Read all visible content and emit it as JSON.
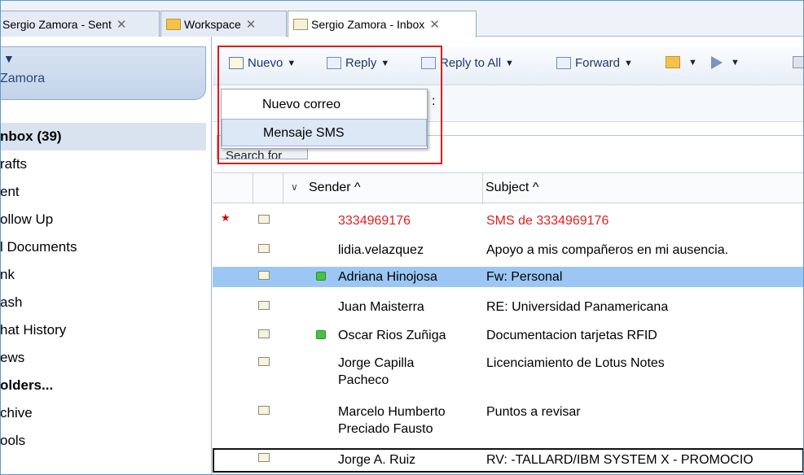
{
  "tabs": [
    {
      "label": "Sergio Zamora - Sent",
      "icon": "none"
    },
    {
      "label": "Workspace",
      "icon": "folder-icon"
    },
    {
      "label": "Sergio Zamora - Inbox",
      "icon": "mail-icon"
    }
  ],
  "tab_close": "✕",
  "navigator": {
    "arrow": "▼",
    "user_name": "Zamora",
    "items": [
      {
        "label": "nbox (39)",
        "selected": true
      },
      {
        "label": "rafts"
      },
      {
        "label": "ent"
      },
      {
        "label": "ollow Up"
      },
      {
        "label": "l Documents"
      },
      {
        "label": "nk"
      },
      {
        "label": "ash"
      },
      {
        "label": "hat History"
      },
      {
        "label": "ews"
      },
      {
        "label": "olders...",
        "bold": true
      },
      {
        "label": "chive"
      },
      {
        "label": "ools"
      }
    ]
  },
  "toolbar": {
    "new_label": "Nuevo",
    "reply_label": "Reply",
    "reply_all_label": "Reply to All",
    "forward_label": "Forward",
    "caret": "▼"
  },
  "new_menu": {
    "items": [
      "Nuevo correo",
      "Mensaje SMS"
    ]
  },
  "subbar_text": ":",
  "search": {
    "label": "Search for"
  },
  "columns": {
    "sender": "Sender ^",
    "subject": "Subject ^",
    "sort_glyph": "∨"
  },
  "messages": [
    {
      "sender": "3334969176",
      "subject": "SMS de 3334969176",
      "unread": true,
      "star": "★"
    },
    {
      "sender": "lidia.velazquez",
      "subject": "Apoyo a mis compañeros en mi ausencia."
    },
    {
      "sender": "Adriana Hinojosa",
      "subject": "Fw: Personal",
      "selected": true,
      "online": true
    },
    {
      "sender": "Juan Maisterra",
      "subject": "RE: Universidad Panamericana"
    },
    {
      "sender": "Oscar Rios Zuñiga",
      "subject": "Documentacion tarjetas RFID",
      "online": true
    },
    {
      "sender": "Jorge Capilla Pacheco",
      "subject": "Licenciamiento de Lotus Notes"
    },
    {
      "sender": "Marcelo Humberto Preciado Fausto",
      "subject": "Puntos a revisar"
    },
    {
      "sender": "Jorge A. Ruiz",
      "subject": "RV:  -TALLARD/IBM SYSTEM X - PROMOCIO"
    }
  ]
}
